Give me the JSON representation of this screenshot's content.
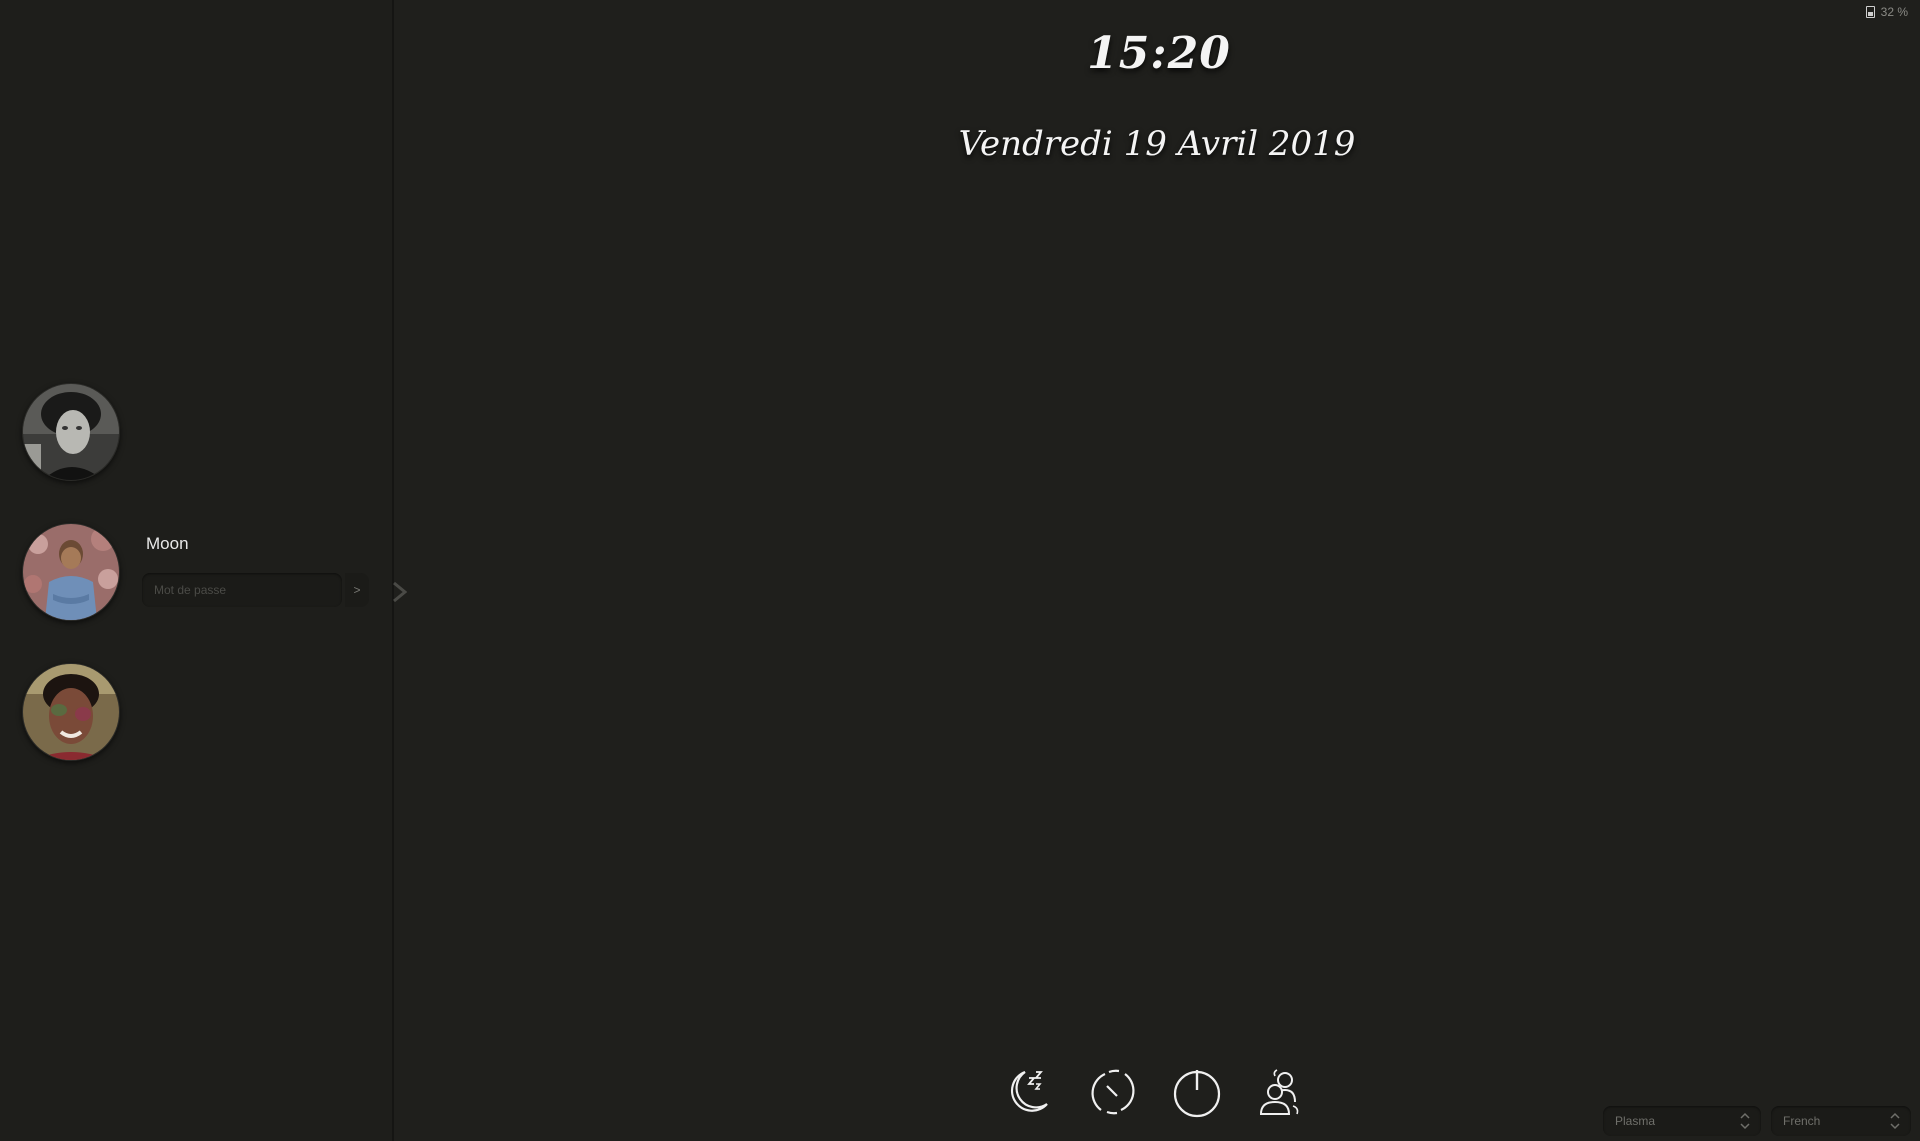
{
  "clock": {
    "time": "15:20"
  },
  "date": {
    "text": "Vendredi 19 Avril 2019"
  },
  "battery": {
    "percent_label": "32 %",
    "level": 0.32
  },
  "users": [
    {
      "name": "",
      "avatar": "avatar-man-bw"
    },
    {
      "name": "Moon",
      "avatar": "avatar-man-flowers",
      "selected": true
    },
    {
      "name": "",
      "avatar": "avatar-woman-color"
    }
  ],
  "login": {
    "password_placeholder": "Mot de passe",
    "submit_label": ">"
  },
  "actions": [
    {
      "name": "suspend",
      "icon": "moon-sleep-icon"
    },
    {
      "name": "reboot",
      "icon": "restart-icon"
    },
    {
      "name": "shutdown",
      "icon": "power-icon"
    },
    {
      "name": "switch-user",
      "icon": "switch-user-icon"
    }
  ],
  "session_selector": {
    "value": "Plasma"
  },
  "language_selector": {
    "value": "French"
  },
  "colors": {
    "background": "#1f1f1c",
    "panel": "#1e1e1b",
    "text": "#f4f4f4",
    "muted": "#6f6f6a"
  }
}
